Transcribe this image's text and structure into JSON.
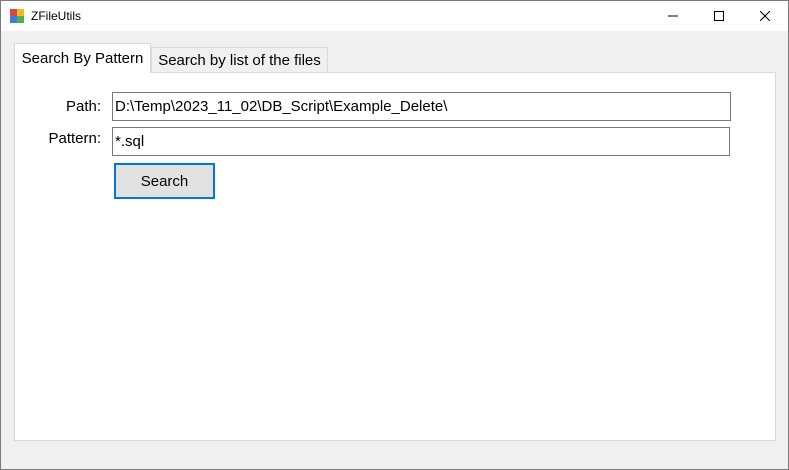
{
  "window": {
    "title": "ZFileUtils",
    "controls": {
      "minimize_icon": "minimize-icon",
      "maximize_icon": "maximize-icon",
      "close_icon": "close-icon"
    }
  },
  "tabs": [
    {
      "label": "Search By Pattern",
      "active": true
    },
    {
      "label": "Search by list of the files",
      "active": false
    }
  ],
  "form": {
    "path_label": "Path:",
    "path_value": "D:\\Temp\\2023_11_02\\DB_Script\\Example_Delete\\",
    "pattern_label": "Pattern:",
    "pattern_value": "*.sql",
    "search_button": "Search"
  },
  "colors": {
    "accent": "#0078d7",
    "panel_bg": "#ffffff",
    "window_bg": "#f0f0f0"
  }
}
